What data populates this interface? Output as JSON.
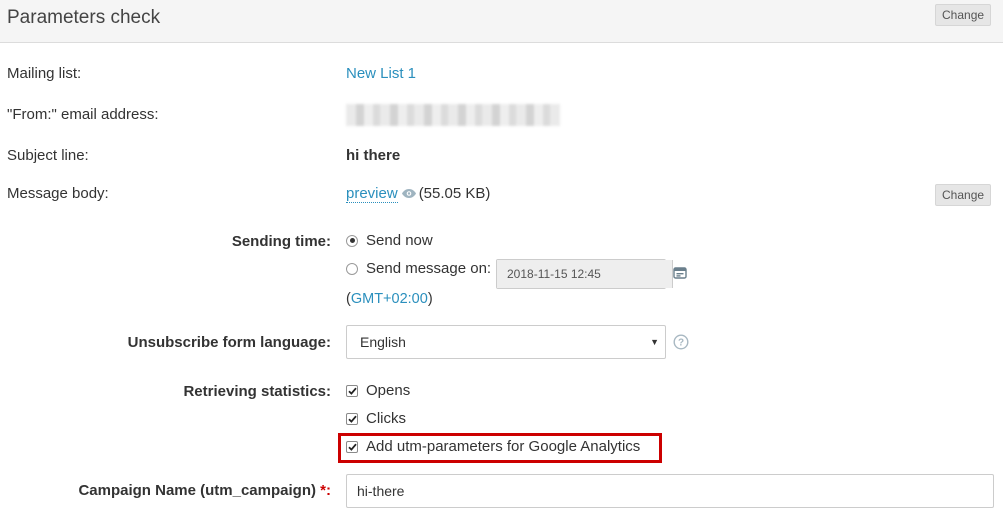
{
  "header": {
    "title": "Parameters check",
    "change_label": "Change"
  },
  "summary": {
    "mailing_list_label": "Mailing list:",
    "mailing_list_value": "New List 1",
    "from_label": "\"From:\" email address:",
    "subject_label": "Subject line:",
    "subject_value": "hi there",
    "body_label": "Message body:",
    "body_preview_link": "preview",
    "body_size": "(55.05 KB)",
    "body_change_label": "Change"
  },
  "sending_time": {
    "label": "Sending time:",
    "option_now": "Send now",
    "option_scheduled": "Send message on:",
    "selected": "Send now",
    "date_value": "2018-11-15 12:45",
    "tz_open": "(",
    "tz_link": "GMT+02:00",
    "tz_close": ")"
  },
  "unsubscribe": {
    "label": "Unsubscribe form language:",
    "selected": "English"
  },
  "statistics": {
    "label": "Retrieving statistics:",
    "opens": "Opens",
    "clicks": "Clicks",
    "utm": "Add utm-parameters for Google Analytics",
    "opens_checked": true,
    "clicks_checked": true,
    "utm_checked": true
  },
  "campaign": {
    "label": "Campaign Name (utm_campaign)",
    "required_mark": "*:",
    "value": "hi-there"
  },
  "colors": {
    "link": "#2a8fbd",
    "highlight": "#cc0000",
    "header_bg": "#f5f5f5"
  }
}
